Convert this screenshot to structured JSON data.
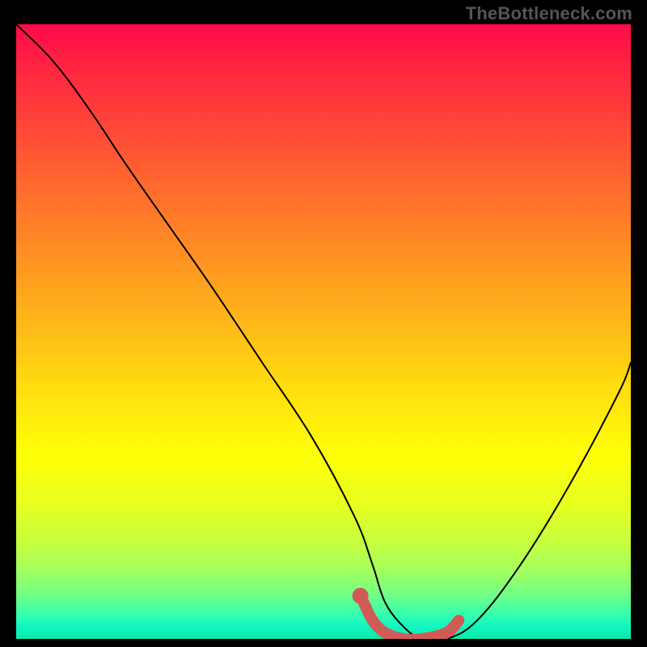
{
  "watermark": "TheBottleneck.com",
  "chart_data": {
    "type": "line",
    "title": "",
    "xlabel": "",
    "ylabel": "",
    "xlim": [
      0,
      100
    ],
    "ylim": [
      0,
      100
    ],
    "series": [
      {
        "name": "bottleneck-curve",
        "color": "#000000",
        "stroke_width": 2,
        "x": [
          0,
          6,
          12,
          18,
          25,
          32,
          40,
          48,
          55,
          58,
          60,
          63,
          66,
          70,
          75,
          82,
          90,
          98,
          100
        ],
        "y": [
          100,
          94,
          86,
          77,
          67,
          57,
          45,
          33,
          20,
          12,
          6,
          2,
          0,
          0,
          3,
          12,
          25,
          40,
          45
        ]
      },
      {
        "name": "highlight-segment",
        "color": "#d15a57",
        "stroke_width": 14,
        "linecap": "round",
        "x": [
          56.5,
          58,
          60,
          63,
          66,
          70,
          72
        ],
        "y": [
          6,
          3,
          1,
          0,
          0,
          1,
          3
        ]
      }
    ],
    "markers": [
      {
        "name": "highlight-dot",
        "x": 56,
        "y": 7,
        "r": 10,
        "color": "#d15a57"
      }
    ],
    "background_gradient": {
      "direction": "vertical",
      "stops": [
        {
          "pos": 0,
          "color": "#ff0b49"
        },
        {
          "pos": 22,
          "color": "#ff5a32"
        },
        {
          "pos": 46,
          "color": "#ffae1b"
        },
        {
          "pos": 70,
          "color": "#feff07"
        },
        {
          "pos": 88,
          "color": "#8dff6e"
        },
        {
          "pos": 100,
          "color": "#0be9a9"
        }
      ]
    }
  }
}
